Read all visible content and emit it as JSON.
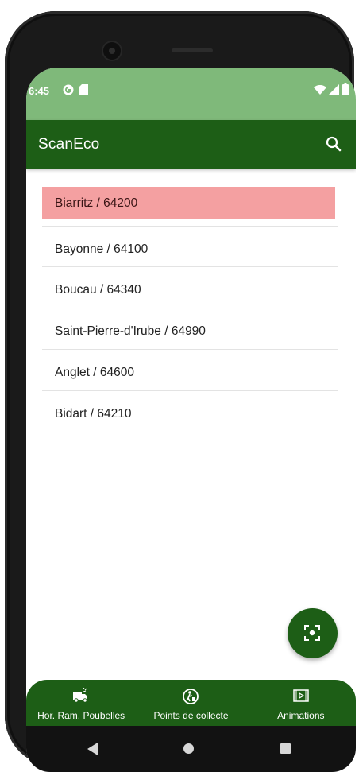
{
  "status_bar": {
    "time": "6:45",
    "background": "#7fb97a"
  },
  "app_bar": {
    "title": "ScanEco",
    "background": "#1d5e16",
    "search_icon": "search-icon"
  },
  "city_list": {
    "selected_color": "#f4a0a1",
    "items": [
      {
        "label": "Biarritz / 64200",
        "selected": true
      },
      {
        "label": "Bayonne / 64100",
        "selected": false
      },
      {
        "label": "Boucau / 64340",
        "selected": false
      },
      {
        "label": "Saint-Pierre-d'Irube / 64990",
        "selected": false
      },
      {
        "label": "Anglet / 64600",
        "selected": false
      },
      {
        "label": "Bidart / 64210",
        "selected": false
      }
    ]
  },
  "fab": {
    "icon": "scan-icon"
  },
  "bottom_nav": {
    "items": [
      {
        "label": "Hor. Ram. Poubelles",
        "icon": "garbage-truck-icon"
      },
      {
        "label": "Points de collecte",
        "icon": "recycling-person-icon"
      },
      {
        "label": "Animations",
        "icon": "video-play-icon"
      }
    ]
  }
}
